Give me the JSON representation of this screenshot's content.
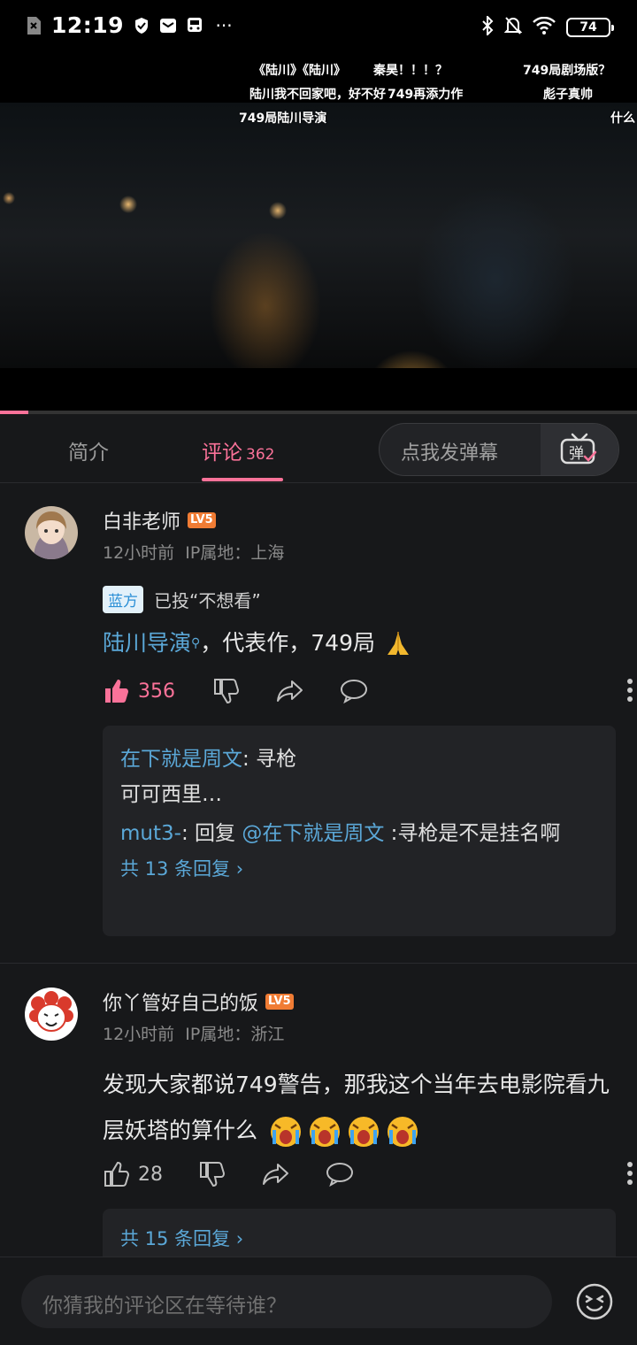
{
  "statusbar": {
    "time": "12:19",
    "battery": "74"
  },
  "video": {
    "danmaku": [
      "《陆川》《陆川》",
      "秦昊！！！？",
      "749局剧场版？",
      "陆川我不回家吧，好不好",
      "749再添力作",
      "彪子真帅",
      "749局陆川导演",
      "什么"
    ],
    "progress_fraction": 0.045
  },
  "tabs": {
    "intro": "简介",
    "comments": "评论",
    "comments_count": "362",
    "danmaku_placeholder": "点我发弹幕",
    "danmaku_button": "弹"
  },
  "comments": [
    {
      "user": "白非老师",
      "level": "LV5",
      "time": "12小时前",
      "ip": "IP属地：上海",
      "vote_tag": "蓝方",
      "vote_text": "已投“不想看”",
      "text_link": "陆川导演",
      "text_rest": "，代表作，749局",
      "likes": "356",
      "replies": [
        {
          "user": "在下就是周文",
          "sep": ": ",
          "text": "寻枪"
        },
        {
          "text": "可可西里…"
        },
        {
          "user": "mut3-",
          "sep": ": 回复 ",
          "mention": "@在下就是周文",
          "text": " :寻枪是不是挂名啊"
        }
      ],
      "more_replies": "共 13 条回复 ›"
    },
    {
      "user": "你丫管好自己的饭",
      "level": "LV5",
      "time": "12小时前",
      "ip": "IP属地：浙江",
      "text": "发现大家都说749警告，那我这个当年去电影院看九层妖塔的算什么",
      "likes": "28",
      "more_replies": "共 15 条回复 ›"
    }
  ],
  "bottom": {
    "placeholder": "你猜我的评论区在等待谁？"
  },
  "colors": {
    "accent": "#fb7299",
    "link": "#5ba8d8",
    "level_badge": "#f07c34",
    "background": "#17181a"
  }
}
